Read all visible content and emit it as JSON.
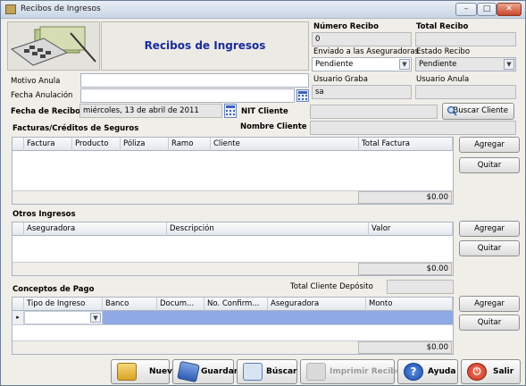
{
  "window": {
    "title": "Recibos de Ingresos",
    "header_title": "Recibos de Ingresos"
  },
  "labels": {
    "numero_recibo": "Número Recibo",
    "total_recibo": "Total Recibo",
    "enviado": "Enviado a las Aseguradoras",
    "estado_recibo": "Estado Recibo",
    "motivo_anula": "Motivo Anula",
    "fecha_anulacion": "Fecha Anulación",
    "usuario_graba": "Usuario Graba",
    "usuario_anula": "Usuario Anula",
    "fecha_recibo": "Fecha de Recibo",
    "nit_cliente": "NIT Cliente",
    "nombre_cliente": "Nombre Cliente",
    "facturas": "Facturas/Créditos de Seguros",
    "otros_ingresos": "Otros Ingresos",
    "conceptos_pago": "Conceptos de Pago",
    "total_cliente_deposito": "Total Cliente Depósito"
  },
  "fields": {
    "numero_recibo": "0",
    "total_recibo": "",
    "enviado": "Pendiente",
    "estado_recibo": "Pendiente",
    "motivo_anula": "",
    "fecha_anulacion": "",
    "usuario_graba": "sa",
    "usuario_anula": "",
    "fecha_recibo": "miércoles, 13 de abril de 2011",
    "nit_cliente": "",
    "nombre_cliente": "",
    "total_cliente_deposito": ""
  },
  "buttons": {
    "buscar_cliente": "Buscar Cliente",
    "agregar": "Agregar",
    "quitar": "Quitar"
  },
  "facturas_grid": {
    "columns": [
      "Factura",
      "Producto",
      "Póliza",
      "Ramo",
      "Cliente",
      "Total Factura"
    ],
    "total": "$0.00"
  },
  "otros_grid": {
    "columns": [
      "Aseguradora",
      "Descripción",
      "Valor"
    ],
    "total": "$0.00"
  },
  "conceptos_grid": {
    "columns": [
      "Tipo de Ingreso",
      "Banco",
      "Docum...",
      "No. Confirm...",
      "Aseguradora",
      "Monto"
    ],
    "total": "$0.00"
  },
  "toolbar": {
    "nuevo": "Nuevo",
    "guardar": "Guardar",
    "buscar": "Búscar",
    "imprimir": "Imprimir Recibo",
    "ayuda": "Ayuda",
    "salir": "Salir"
  },
  "colors": {
    "header_title": "#1a2c9c",
    "selected_row": "#8fa8e6"
  }
}
